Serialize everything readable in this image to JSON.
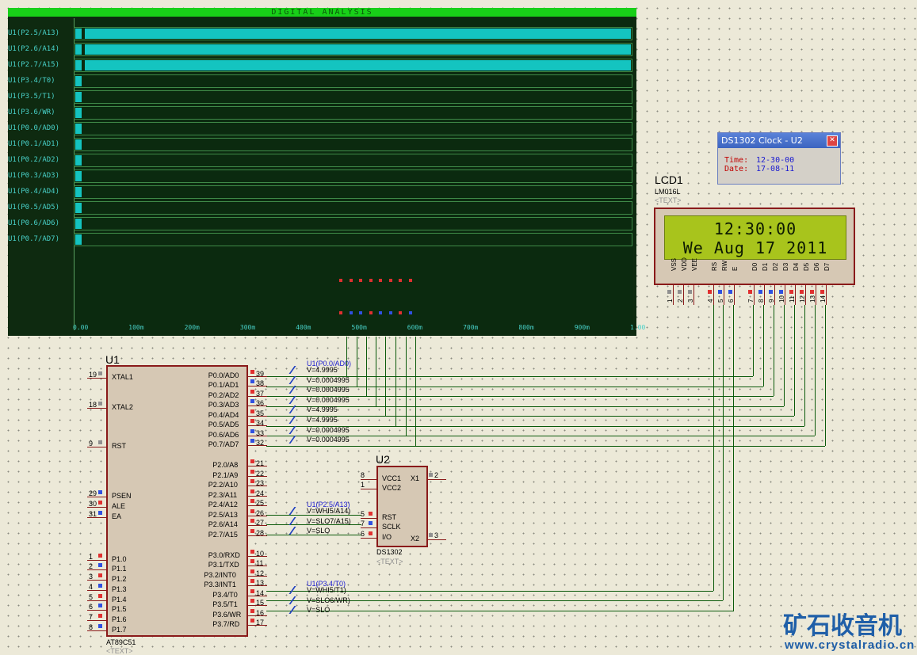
{
  "scope": {
    "title": "DIGITAL ANALYSIS",
    "traces": [
      {
        "label": "U1(P2.5/A13)",
        "state": "high"
      },
      {
        "label": "U1(P2.6/A14)",
        "state": "high"
      },
      {
        "label": "U1(P2.7/A15)",
        "state": "high"
      },
      {
        "label": "U1(P3.4/T0)",
        "state": "low"
      },
      {
        "label": "U1(P3.5/T1)",
        "state": "low"
      },
      {
        "label": "U1(P3.6/WR)",
        "state": "low"
      },
      {
        "label": "U1(P0.0/AD0)",
        "state": "low"
      },
      {
        "label": "U1(P0.1/AD1)",
        "state": "low"
      },
      {
        "label": "U1(P0.2/AD2)",
        "state": "low"
      },
      {
        "label": "U1(P0.3/AD3)",
        "state": "low"
      },
      {
        "label": "U1(P0.4/AD4)",
        "state": "low"
      },
      {
        "label": "U1(P0.5/AD5)",
        "state": "low"
      },
      {
        "label": "U1(P0.6/AD6)",
        "state": "low"
      },
      {
        "label": "U1(P0.7/AD7)",
        "state": "low"
      }
    ],
    "time_ticks": [
      "0.00",
      "100m",
      "200m",
      "300m",
      "400m",
      "500m",
      "600m",
      "700m",
      "800m",
      "900m",
      "1.00"
    ]
  },
  "u1": {
    "ref": "U1",
    "part": "AT89C51",
    "text_tag": "<TEXT>",
    "left_pins": [
      {
        "num": "19",
        "name": "XTAL1"
      },
      {
        "num": "18",
        "name": "XTAL2"
      },
      {
        "num": "9",
        "name": "RST"
      },
      {
        "num": "29",
        "name": "PSEN"
      },
      {
        "num": "30",
        "name": "ALE"
      },
      {
        "num": "31",
        "name": "EA"
      },
      {
        "num": "1",
        "name": "P1.0"
      },
      {
        "num": "2",
        "name": "P1.1"
      },
      {
        "num": "3",
        "name": "P1.2"
      },
      {
        "num": "4",
        "name": "P1.3"
      },
      {
        "num": "5",
        "name": "P1.4"
      },
      {
        "num": "6",
        "name": "P1.5"
      },
      {
        "num": "7",
        "name": "P1.6"
      },
      {
        "num": "8",
        "name": "P1.7"
      }
    ],
    "right_pins": [
      {
        "num": "39",
        "name": "P0.0/AD0"
      },
      {
        "num": "38",
        "name": "P0.1/AD1"
      },
      {
        "num": "37",
        "name": "P0.2/AD2"
      },
      {
        "num": "36",
        "name": "P0.3/AD3"
      },
      {
        "num": "35",
        "name": "P0.4/AD4"
      },
      {
        "num": "34",
        "name": "P0.5/AD5"
      },
      {
        "num": "33",
        "name": "P0.6/AD6"
      },
      {
        "num": "32",
        "name": "P0.7/AD7"
      },
      {
        "num": "21",
        "name": "P2.0/A8"
      },
      {
        "num": "22",
        "name": "P2.1/A9"
      },
      {
        "num": "23",
        "name": "P2.2/A10"
      },
      {
        "num": "24",
        "name": "P2.3/A11"
      },
      {
        "num": "25",
        "name": "P2.4/A12"
      },
      {
        "num": "26",
        "name": "P2.5/A13"
      },
      {
        "num": "27",
        "name": "P2.6/A14"
      },
      {
        "num": "28",
        "name": "P2.7/A15"
      },
      {
        "num": "10",
        "name": "P3.0/RXD"
      },
      {
        "num": "11",
        "name": "P3.1/TXD"
      },
      {
        "num": "12",
        "name": "P3.2/INT0"
      },
      {
        "num": "13",
        "name": "P3.3/INT1"
      },
      {
        "num": "14",
        "name": "P3.4/T0"
      },
      {
        "num": "15",
        "name": "P3.5/T1"
      },
      {
        "num": "16",
        "name": "P3.6/WR"
      },
      {
        "num": "17",
        "name": "P3.7/RD"
      }
    ]
  },
  "probes": {
    "p0_label": "U1(P0.0/AD0)",
    "p0_values": [
      "V=4.9995",
      "V=0.0004995",
      "V=0.0004995",
      "V=0.0004995",
      "V=4.9995",
      "V=4.9995",
      "V=0.0004995",
      "V=0.0004995"
    ],
    "p2_label": "U1(P2.5/A13)",
    "p2_values": [
      "V=WHI5/A14)",
      "V=SLO7/A15)",
      "V=SLO"
    ],
    "p3_label": "U1(P3.4/T0)",
    "p3_values": [
      "V=WHI5/T1)",
      "V=SLO6/WR)",
      "V=SLO"
    ]
  },
  "u2": {
    "ref": "U2",
    "part": "DS1302",
    "text_tag": "<TEXT>",
    "pins": [
      {
        "num": "8",
        "name": "VCC1"
      },
      {
        "num": "1",
        "name": "VCC2"
      },
      {
        "num": "5",
        "name": "RST"
      },
      {
        "num": "7",
        "name": "SCLK"
      },
      {
        "num": "6",
        "name": "I/O"
      },
      {
        "num": "2",
        "name": "X1"
      },
      {
        "num": "3",
        "name": "X2"
      }
    ]
  },
  "lcd": {
    "ref": "LCD1",
    "part": "LM016L",
    "text_tag": "<TEXT>",
    "line1": "12:30:00",
    "line2": "We Aug 17 2011",
    "pins": [
      {
        "name": "VSS",
        "num": "1"
      },
      {
        "name": "VDD",
        "num": "2"
      },
      {
        "name": "VEE",
        "num": "3"
      },
      {
        "name": "RS",
        "num": "4"
      },
      {
        "name": "RW",
        "num": "5"
      },
      {
        "name": "E",
        "num": "6"
      },
      {
        "name": "D0",
        "num": "7"
      },
      {
        "name": "D1",
        "num": "8"
      },
      {
        "name": "D2",
        "num": "9"
      },
      {
        "name": "D3",
        "num": "10"
      },
      {
        "name": "D4",
        "num": "11"
      },
      {
        "name": "D5",
        "num": "12"
      },
      {
        "name": "D6",
        "num": "13"
      },
      {
        "name": "D7",
        "num": "14"
      }
    ]
  },
  "dialog": {
    "title": "DS1302 Clock - U2",
    "time_key": "Time:",
    "time_val": "12-30-00",
    "date_key": "Date:",
    "date_val": "17-08-11",
    "close_glyph": "✕"
  },
  "watermark": {
    "cn": "矿石收音机",
    "url": "www.crystalradio.cn"
  }
}
